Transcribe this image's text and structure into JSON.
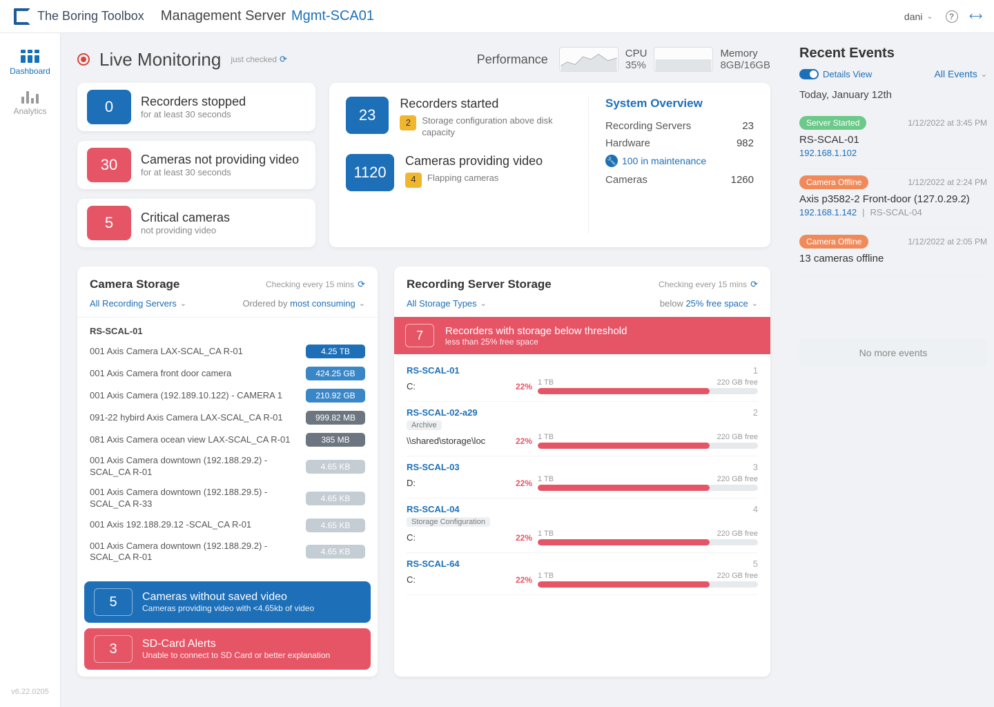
{
  "header": {
    "brand": "The Boring Toolbox",
    "section": "Management Server",
    "server": "Mgmt-SCA01",
    "user": "dani"
  },
  "sidebar": {
    "dashboard": "Dashboard",
    "analytics": "Analytics",
    "version": "v6.22.0205"
  },
  "live": {
    "title": "Live Monitoring",
    "checked": "just checked",
    "perf_label": "Performance",
    "cpu_label": "CPU",
    "cpu_value": "35%",
    "mem_label": "Memory",
    "mem_value": "8GB/16GB"
  },
  "stats": {
    "recorders_stopped": {
      "num": "0",
      "title": "Recorders stopped",
      "sub": "for at least 30 seconds"
    },
    "cameras_no_video": {
      "num": "30",
      "title": "Cameras not providing video",
      "sub": "for at least 30 seconds"
    },
    "critical_cameras": {
      "num": "5",
      "title": "Critical cameras",
      "sub": "not providing video"
    }
  },
  "bigcard": {
    "rec_started": {
      "num": "23",
      "title": "Recorders started",
      "badge": "2",
      "sub": "Storage configuration above disk capacity"
    },
    "cam_providing": {
      "num": "1120",
      "title": "Cameras providing video",
      "badge": "4",
      "sub": "Flapping cameras"
    },
    "overview_title": "System Overview",
    "row1_label": "Recording Servers",
    "row1_val": "23",
    "row2_label": "Hardware",
    "row2_val": "982",
    "maint": "100 in maintenance",
    "row3_label": "Cameras",
    "row3_val": "1260"
  },
  "cam_storage": {
    "title": "Camera Storage",
    "checking": "Checking every 15 mins",
    "filter": "All Recording Servers",
    "order_prefix": "Ordered by ",
    "order_val": "most consuming",
    "server": "RS-SCAL-01",
    "rows": [
      {
        "name": "001 Axis Camera LAX-SCAL_CA R-01",
        "badge": "4.25 TB",
        "cls": "bdg-blue1"
      },
      {
        "name": "001 Axis Camera front door camera",
        "badge": "424.25 GB",
        "cls": "bdg-blue2"
      },
      {
        "name": "001 Axis Camera (192.189.10.122) - CAMERA 1",
        "badge": "210.92 GB",
        "cls": "bdg-blue2"
      },
      {
        "name": "091-22 hybird Axis Camera LAX-SCAL_CA R-01",
        "badge": "999.82 MB",
        "cls": "bdg-gray1"
      },
      {
        "name": "081 Axis Camera ocean view LAX-SCAL_CA R-01",
        "badge": "385 MB",
        "cls": "bdg-gray1"
      },
      {
        "name": "001 Axis Camera downtown (192.188.29.2) -SCAL_CA R-01",
        "badge": "4.65 KB",
        "cls": "bdg-gray2"
      },
      {
        "name": "001 Axis Camera downtown (192.188.29.5) -SCAL_CA R-33",
        "badge": "4.65 KB",
        "cls": "bdg-gray2"
      },
      {
        "name": "001 Axis 192.188.29.12 -SCAL_CA R-01",
        "badge": "4.65 KB",
        "cls": "bdg-gray2"
      },
      {
        "name": "001 Axis Camera downtown (192.188.29.2) -SCAL_CA R-01",
        "badge": "4.65 KB",
        "cls": "bdg-gray2"
      }
    ],
    "foot1": {
      "num": "5",
      "title": "Cameras without saved video",
      "sub": "Cameras providing video with <4.65kb of video"
    },
    "foot2": {
      "num": "3",
      "title": "SD-Card Alerts",
      "sub": "Unable to connect to SD Card or better explanation"
    }
  },
  "rec_storage": {
    "title": "Recording Server Storage",
    "checking": "Checking every 15 mins",
    "filter": "All Storage Types",
    "below_prefix": "below ",
    "below_val": "25% free space",
    "threshold": {
      "num": "7",
      "title": "Recorders with storage below threshold",
      "sub": "less than 25% free space"
    },
    "items": [
      {
        "name": "RS-SCAL-01",
        "idx": "1",
        "tag": "",
        "drive": "C:",
        "pct": "22%",
        "total": "1 TB",
        "free": "220 GB free",
        "fill": 78
      },
      {
        "name": "RS-SCAL-02-a29",
        "idx": "2",
        "tag": "Archive",
        "drive": "\\\\shared\\storage\\loc",
        "pct": "22%",
        "total": "1 TB",
        "free": "220 GB free",
        "fill": 78
      },
      {
        "name": "RS-SCAL-03",
        "idx": "3",
        "tag": "",
        "drive": "D:",
        "pct": "22%",
        "total": "1 TB",
        "free": "220 GB free",
        "fill": 78
      },
      {
        "name": "RS-SCAL-04",
        "idx": "4",
        "tag": "Storage Configuration",
        "drive": "C:",
        "pct": "22%",
        "total": "1 TB",
        "free": "220 GB free",
        "fill": 78
      },
      {
        "name": "RS-SCAL-64",
        "idx": "5",
        "tag": "",
        "drive": "C:",
        "pct": "22%",
        "total": "1 TB",
        "free": "220 GB free",
        "fill": 78
      }
    ]
  },
  "events": {
    "title": "Recent Events",
    "details": "Details View",
    "all": "All Events",
    "date": "Today, January 12th",
    "items": [
      {
        "badge": "Server Started",
        "badge_cls": "evb-green",
        "time": "1/12/2022 at 3:45 PM",
        "main": "RS-SCAL-01",
        "ip": "192.168.1.102",
        "extra": ""
      },
      {
        "badge": "Camera Offline",
        "badge_cls": "evb-orange",
        "time": "1/12/2022 at 2:24 PM",
        "main": "Axis p3582-2 Front-door (127.0.29.2)",
        "ip": "192.168.1.142",
        "extra": "RS-SCAL-04"
      },
      {
        "badge": "Camera Offline",
        "badge_cls": "evb-orange",
        "time": "1/12/2022 at 2:05 PM",
        "main": "13 cameras offline",
        "ip": "",
        "extra": ""
      }
    ],
    "no_more": "No more events"
  }
}
